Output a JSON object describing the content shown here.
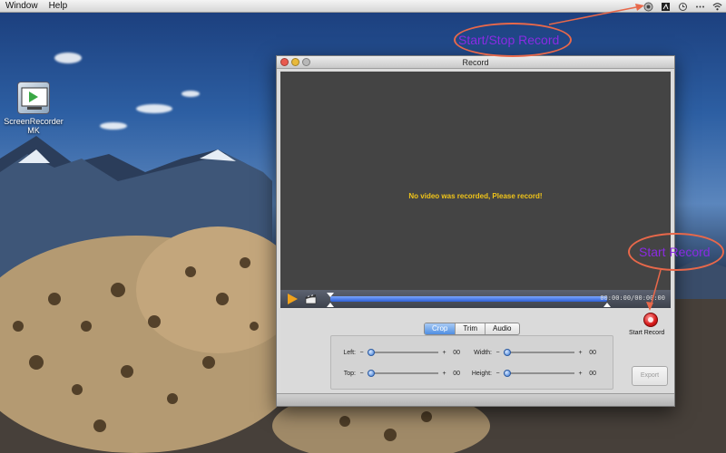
{
  "menubar": {
    "items": [
      "Window",
      "Help"
    ],
    "status_icons": [
      "record-status-icon",
      "app-status-icon",
      "time-machine-icon",
      "spaces-icon",
      "wifi-icon"
    ]
  },
  "desktop": {
    "icon_label_line1": "ScreenRecorder",
    "icon_label_line2": "MK"
  },
  "annotations": {
    "start_stop": "Start/Stop Record",
    "start_record": "Start Record",
    "color": "#8a2be2",
    "ellipse_color": "#e8684a"
  },
  "window": {
    "title": "Record",
    "preview_message": "No video was recorded, Please record!",
    "timecode": "00:00:00/00:00:00",
    "tabs": [
      "Crop",
      "Trim",
      "Audio"
    ],
    "active_tab": "Crop",
    "controls": {
      "left": {
        "label": "Left:",
        "minus": "−",
        "plus": "+",
        "value": "00"
      },
      "width": {
        "label": "Width:",
        "minus": "−",
        "plus": "+",
        "value": "00"
      },
      "top": {
        "label": "Top:",
        "minus": "−",
        "plus": "+",
        "value": "00"
      },
      "height": {
        "label": "Height:",
        "minus": "−",
        "plus": "+",
        "value": "00"
      }
    },
    "start_record_label": "Start Record",
    "export_label": "Export"
  }
}
